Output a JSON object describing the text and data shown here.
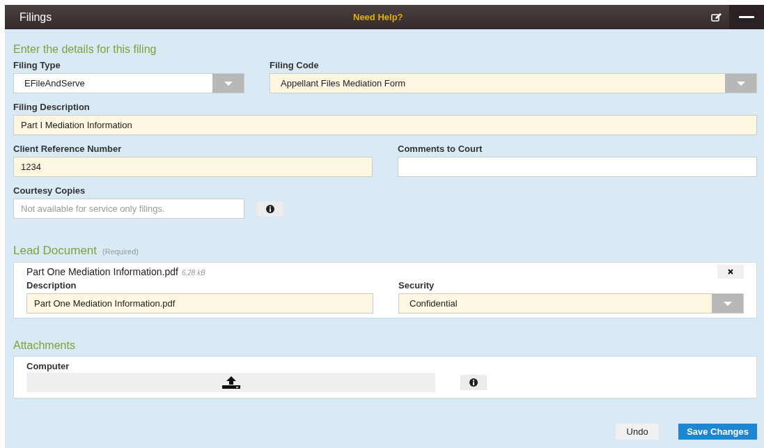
{
  "header": {
    "title": "Filings",
    "help_link": "Need Help?"
  },
  "details": {
    "heading": "Enter the details for this filing",
    "filing_type": {
      "label": "Filing Type",
      "value": "EFileAndServe"
    },
    "filing_code": {
      "label": "Filing Code",
      "value": "Appellant Files Mediation Form"
    },
    "filing_description": {
      "label": "Filing Description",
      "value": "Part I Mediation Information"
    },
    "client_reference": {
      "label": "Client Reference Number",
      "value": "1234"
    },
    "comments_to_court": {
      "label": "Comments to Court"
    },
    "courtesy_copies": {
      "label": "Courtesy Copies",
      "placeholder": "Not available for service only filings."
    }
  },
  "lead_document": {
    "heading": "Lead Document",
    "note": "(Required)",
    "file_name": "Part One Mediation Information.pdf",
    "file_size": "6.28 kB",
    "description": {
      "label": "Description",
      "value": "Part One Mediation Information.pdf"
    },
    "security": {
      "label": "Security",
      "value": "Confidential"
    }
  },
  "attachments": {
    "heading": "Attachments",
    "source_label": "Computer"
  },
  "buttons": {
    "undo": "Undo",
    "save": "Save Changes"
  }
}
